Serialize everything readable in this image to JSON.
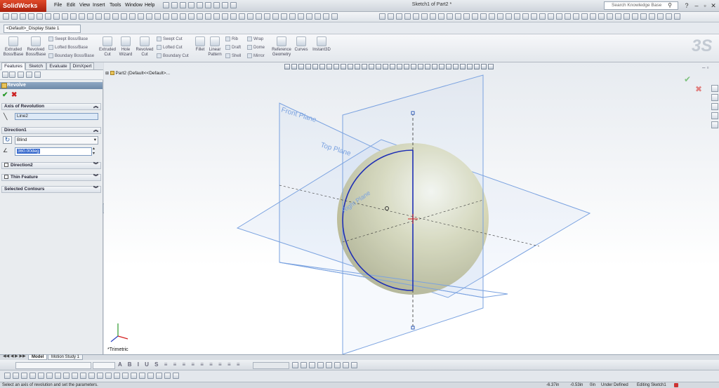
{
  "app": {
    "brand": "SolidWorks",
    "doc_title": "Sketch1 of Part2 *"
  },
  "menu": [
    "File",
    "Edit",
    "View",
    "Insert",
    "Tools",
    "Window",
    "Help"
  ],
  "search": {
    "placeholder": "Search Knowledge Base"
  },
  "config": {
    "selected": "<Default>_Display State 1"
  },
  "commands": {
    "extruded_boss": "Extruded Boss/Base",
    "revolved_boss": "Revolved Boss/Base",
    "swept_boss": "Swept Boss/Base",
    "lofted_boss": "Lofted Boss/Base",
    "boundary_boss": "Boundary Boss/Base",
    "extruded_cut": "Extruded Cut",
    "hole_wizard": "Hole Wizard",
    "revolved_cut": "Revolved Cut",
    "swept_cut": "Swept Cut",
    "lofted_cut": "Lofted Cut",
    "boundary_cut": "Boundary Cut",
    "fillet": "Fillet",
    "linear_pattern": "Linear Pattern",
    "rib": "Rib",
    "draft": "Draft",
    "shell": "Shell",
    "wrap": "Wrap",
    "dome": "Dome",
    "mirror": "Mirror",
    "reference_geometry": "Reference Geometry",
    "curves": "Curves",
    "instant3d": "Instant3D"
  },
  "tabs": [
    "Features",
    "Sketch",
    "Evaluate",
    "DimXpert"
  ],
  "property_manager": {
    "title": "Revolve",
    "axis_group": "Axis of Revolution",
    "axis_value": "Line2",
    "direction1_group": "Direction1",
    "direction1_type": "Blind",
    "angle": "360.00deg",
    "direction2_group": "Direction2",
    "thin_feature_group": "Thin Feature",
    "selected_contours_group": "Selected Contours"
  },
  "tree": {
    "root": "Part2  (Default<<Default>..."
  },
  "viewport": {
    "front_plane": "Front Plane",
    "top_plane": "Top Plane",
    "right_plane": "Right Plane",
    "view_orientation": "*Trimetric",
    "sphere_color": "#dcdcbc",
    "plane_color": "#7aa2e0",
    "sketch_color": "#1f2fb5"
  },
  "sheet_tabs": [
    "Model",
    "Motion Study 1"
  ],
  "status": {
    "message": "Select an axis of revolution and set the parameters.",
    "x": "-6.37in",
    "y": "-0.53in",
    "z": "0in",
    "state": "Under Defined",
    "mode": "Editing Sketch1"
  }
}
